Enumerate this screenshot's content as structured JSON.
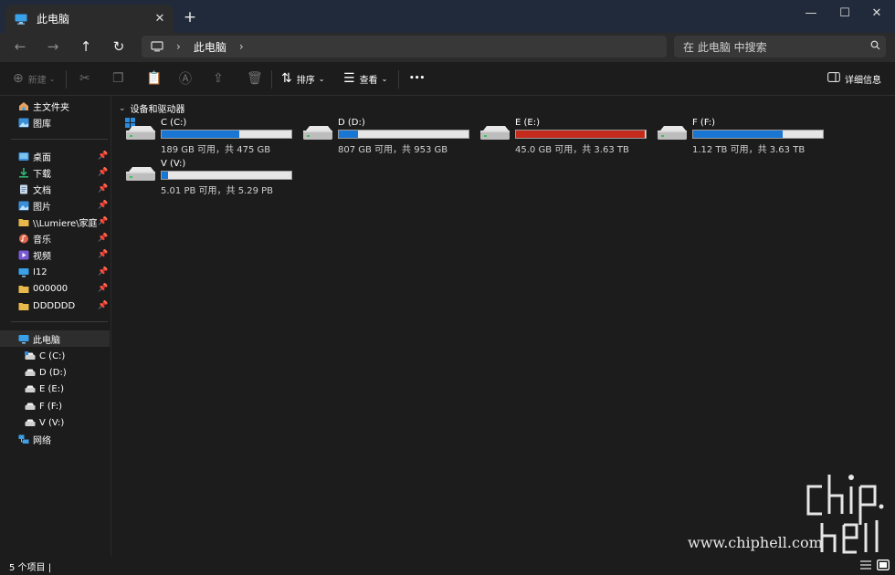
{
  "window": {
    "tab_title": "此电脑",
    "tab_close": "✕",
    "new_tab": "+",
    "minimize": "—",
    "maximize": "☐",
    "close": "✕"
  },
  "address": {
    "breadcrumb": "此电脑",
    "sep1": "›",
    "sep2": "›",
    "search_placeholder": "在 此电脑 中搜索"
  },
  "toolbar": {
    "new_label": "新建",
    "sort_label": "排序",
    "view_label": "查看",
    "more_label": "•••",
    "details_label": "详细信息"
  },
  "nav": {
    "quick": [
      {
        "label": "主文件夹",
        "icon": "home-icon"
      },
      {
        "label": "图库",
        "icon": "gallery-icon"
      }
    ],
    "pinned": [
      {
        "label": "桌面",
        "icon": "desktop-icon",
        "color": "#3a8fd8"
      },
      {
        "label": "下载",
        "icon": "download-icon",
        "color": "#2fb470"
      },
      {
        "label": "文档",
        "icon": "document-icon",
        "color": "#8aa9c9"
      },
      {
        "label": "图片",
        "icon": "pictures-icon",
        "color": "#3a8fd8"
      },
      {
        "label": "\\\\Lumiere\\家庭",
        "icon": "folder-icon",
        "color": "#e8b84a"
      },
      {
        "label": "音乐",
        "icon": "music-icon",
        "color": "#e0664a"
      },
      {
        "label": "视频",
        "icon": "video-icon",
        "color": "#7a5bd6"
      },
      {
        "label": "I12",
        "icon": "monitor-icon",
        "color": "#3a8fd8"
      },
      {
        "label": "000000",
        "icon": "folder-icon",
        "color": "#e8b84a"
      },
      {
        "label": "DDDDDD",
        "icon": "folder-icon",
        "color": "#e8b84a"
      }
    ],
    "pc": {
      "label": "此电脑"
    },
    "drives": [
      "C (C:)",
      "D (D:)",
      "E (E:)",
      "F (F:)",
      "V (V:)"
    ],
    "network": {
      "label": "网络"
    }
  },
  "content": {
    "group_label": "设备和驱动器",
    "drives": [
      {
        "name": "C (C:)",
        "free_text": "189 GB 可用，共 475 GB",
        "used_fraction": 0.6,
        "bar_color": "#1976d2",
        "system": true
      },
      {
        "name": "D (D:)",
        "free_text": "807 GB 可用，共 953 GB",
        "used_fraction": 0.15,
        "bar_color": "#1976d2",
        "system": false
      },
      {
        "name": "E (E:)",
        "free_text": "45.0 GB 可用，共 3.63 TB",
        "used_fraction": 0.99,
        "bar_color": "#c42b1c",
        "system": false
      },
      {
        "name": "F (F:)",
        "free_text": "1.12 TB 可用，共 3.63 TB",
        "used_fraction": 0.69,
        "bar_color": "#1976d2",
        "system": false
      },
      {
        "name": "V (V:)",
        "free_text": "5.01 PB 可用，共 5.29 PB",
        "used_fraction": 0.05,
        "bar_color": "#1976d2",
        "system": false
      }
    ]
  },
  "status": {
    "items_count": "5 个项目",
    "sep": "|"
  },
  "watermark": {
    "url": "www.chiphell.com",
    "logo_text": "chiphell"
  }
}
